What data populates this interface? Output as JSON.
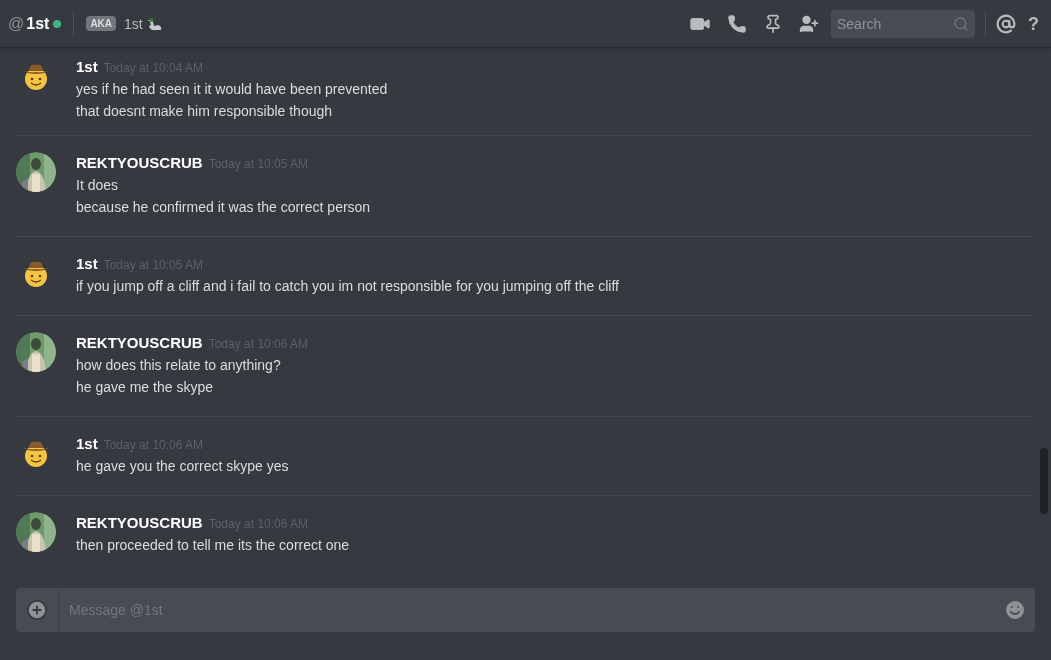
{
  "header": {
    "at": "@",
    "name": "1st",
    "online": true,
    "aka_badge": "AKA",
    "aka_name": "1st",
    "search": {
      "placeholder": "Search"
    },
    "help": "?"
  },
  "messages": [
    {
      "author": "1st",
      "avatar": {
        "kind": "emoji"
      },
      "time": "Today at 10:04 AM",
      "lines": [
        "yes if he had seen it it would have been prevented",
        "that doesnt make him responsible though"
      ]
    },
    {
      "author": "REKTYOUSCRUB",
      "avatar": {
        "kind": "picture"
      },
      "time": "Today at 10:05 AM",
      "lines": [
        "It does",
        "because he confirmed it was the correct person"
      ]
    },
    {
      "author": "1st",
      "avatar": {
        "kind": "emoji"
      },
      "time": "Today at 10:05 AM",
      "lines": [
        "if you jump off a cliff and i fail to catch you im not responsible for you jumping off the cliff"
      ]
    },
    {
      "author": "REKTYOUSCRUB",
      "avatar": {
        "kind": "picture"
      },
      "time": "Today at 10:06 AM",
      "lines": [
        "how does this relate to anything?",
        "he gave me the skype"
      ]
    },
    {
      "author": "1st",
      "avatar": {
        "kind": "emoji"
      },
      "time": "Today at 10:06 AM",
      "lines": [
        "he gave you the correct skype yes"
      ]
    },
    {
      "author": "REKTYOUSCRUB",
      "avatar": {
        "kind": "picture"
      },
      "time": "Today at 10:06 AM",
      "lines": [
        "then proceeded to tell me its the correct one"
      ]
    }
  ],
  "composer": {
    "placeholder": "Message @1st"
  }
}
